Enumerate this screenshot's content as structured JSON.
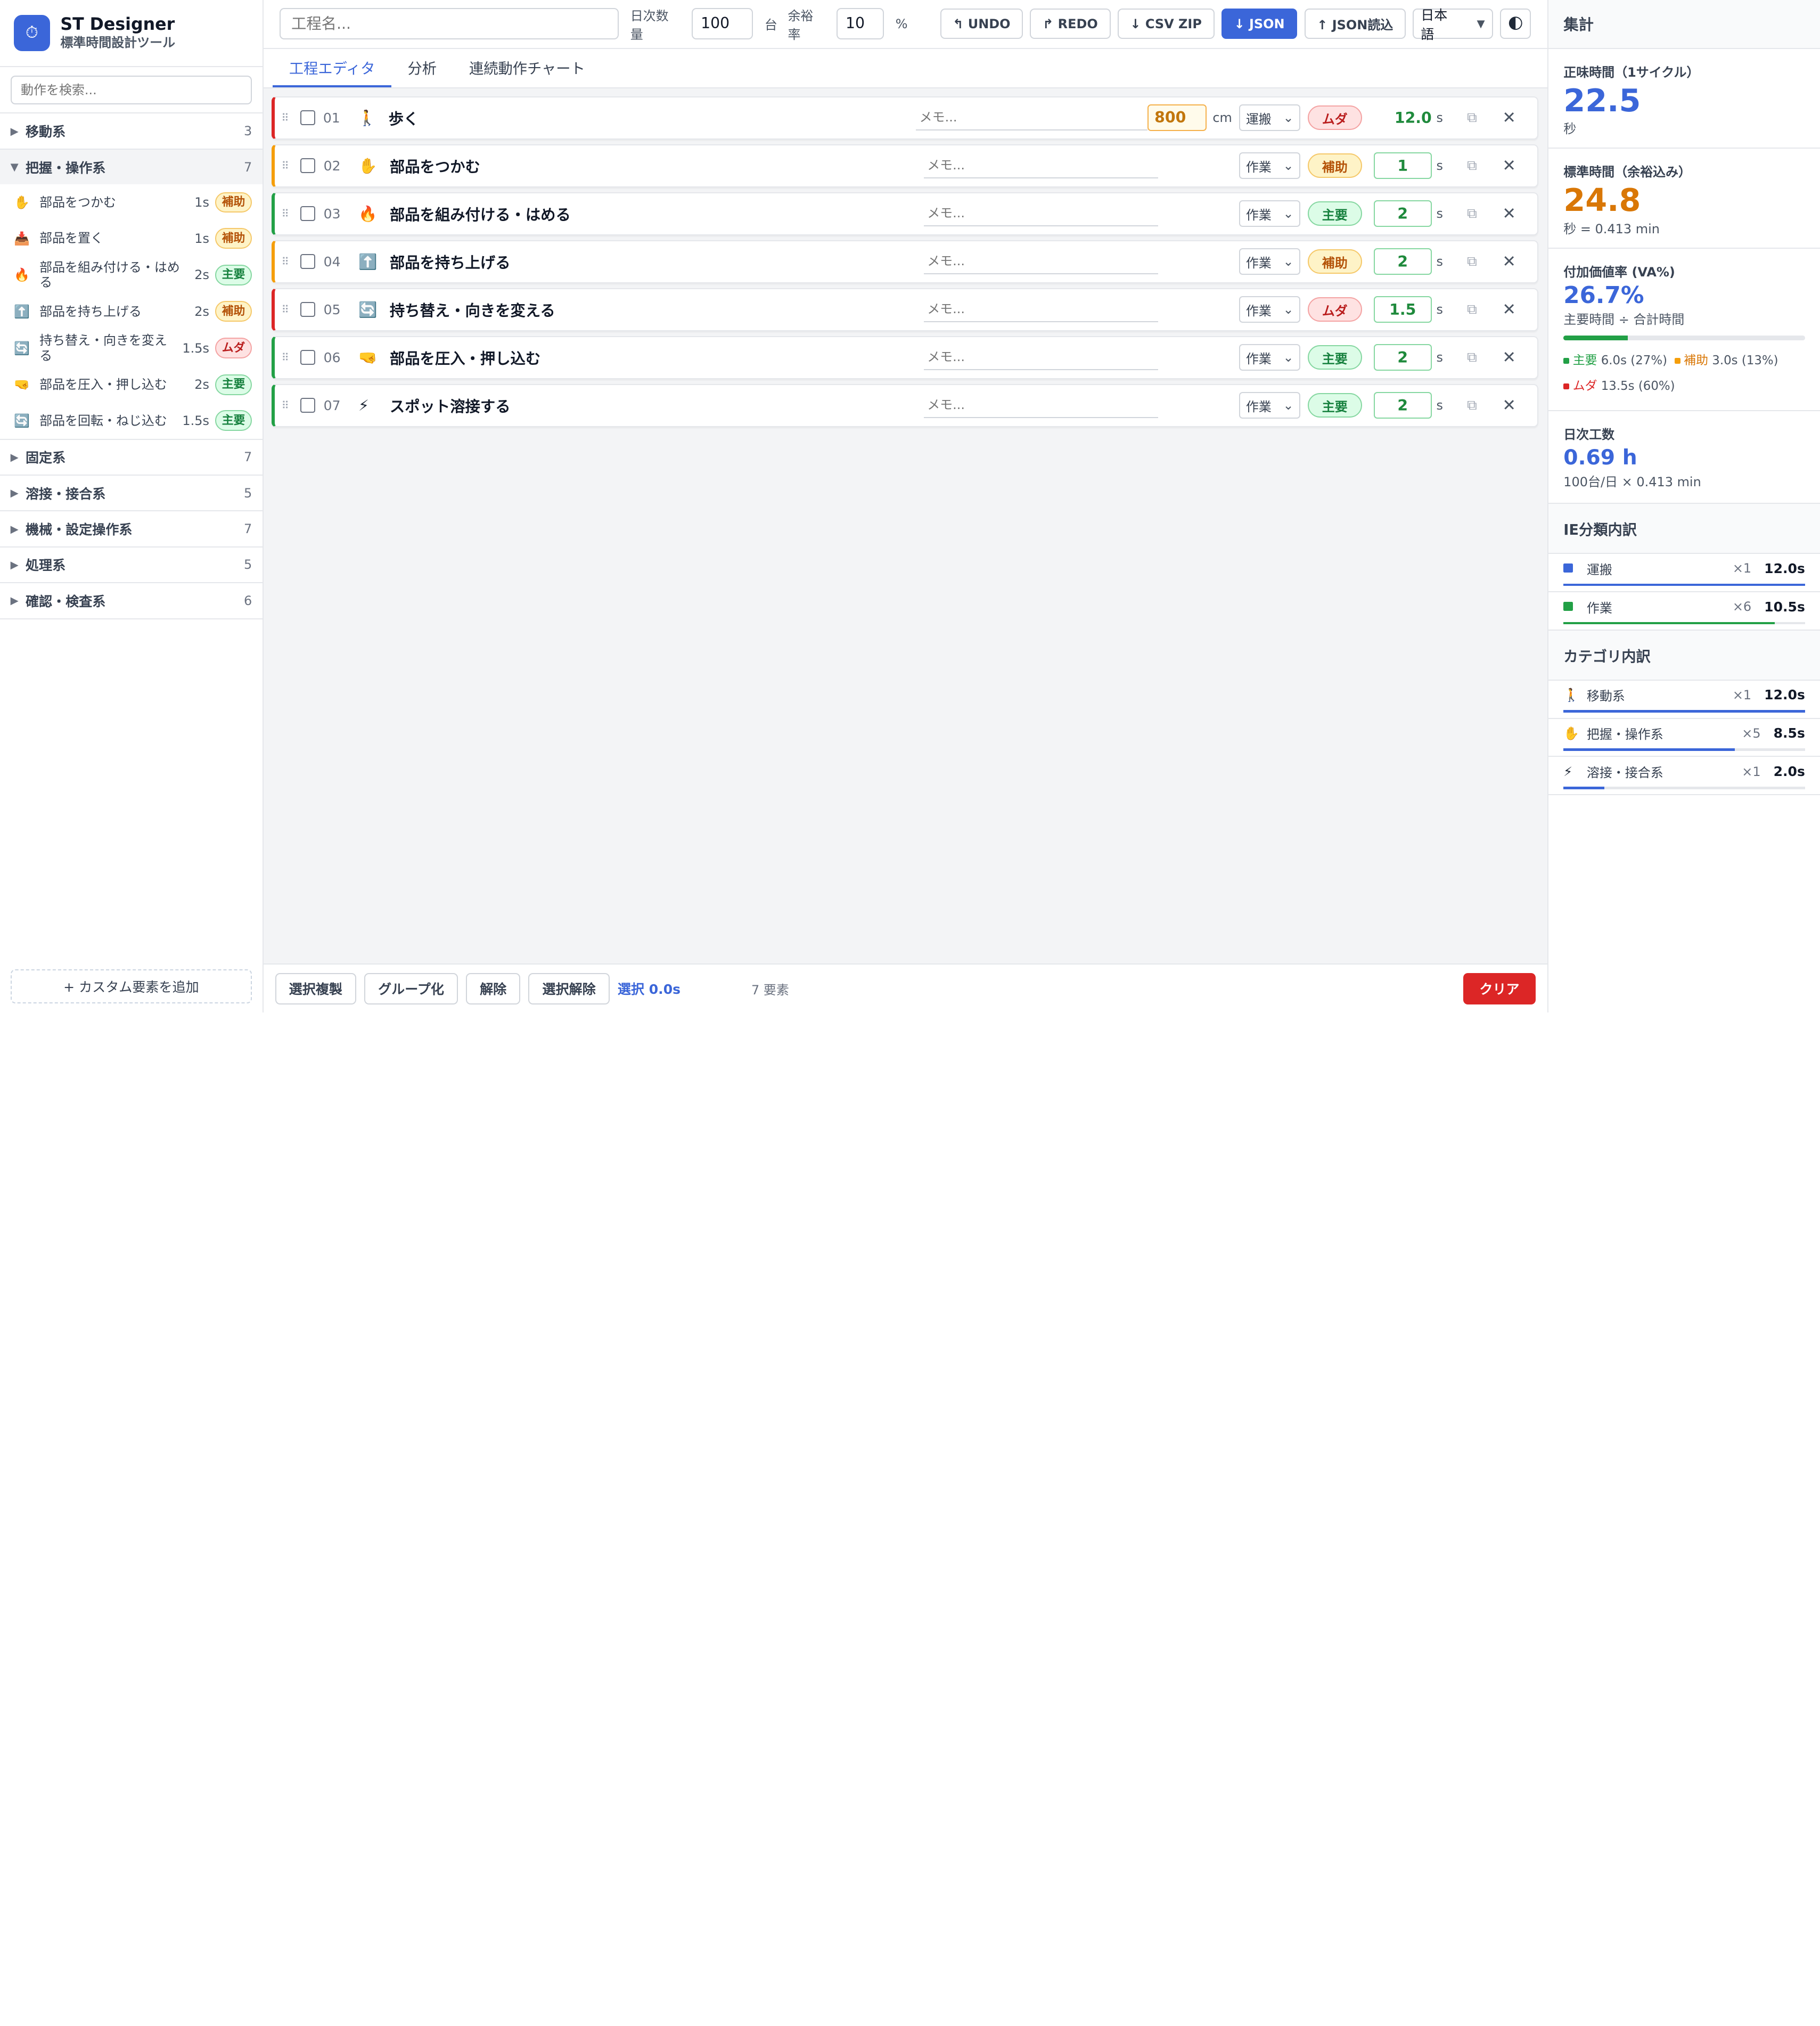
{
  "app": {
    "title": "ST Designer",
    "subtitle": "標準時間設計ツール"
  },
  "sidebar": {
    "search_placeholder": "動作を検索...",
    "categories": [
      {
        "name": "移動系",
        "count": "3",
        "open": false
      },
      {
        "name": "把握・操作系",
        "count": "7",
        "open": true,
        "items": [
          {
            "icon": "✋",
            "name": "部品をつかむ",
            "time": "1s",
            "badge": "補助",
            "kind": "aux"
          },
          {
            "icon": "📥",
            "name": "部品を置く",
            "time": "1s",
            "badge": "補助",
            "kind": "aux"
          },
          {
            "icon": "🔥",
            "name": "部品を組み付ける・はめる",
            "time": "2s",
            "badge": "主要",
            "kind": "main"
          },
          {
            "icon": "⬆️",
            "name": "部品を持ち上げる",
            "time": "2s",
            "badge": "補助",
            "kind": "aux"
          },
          {
            "icon": "🔄",
            "name": "持ち替え・向きを変える",
            "time": "1.5s",
            "badge": "ムダ",
            "kind": "muda"
          },
          {
            "icon": "🤜",
            "name": "部品を圧入・押し込む",
            "time": "2s",
            "badge": "主要",
            "kind": "main"
          },
          {
            "icon": "🔄",
            "name": "部品を回転・ねじ込む",
            "time": "1.5s",
            "badge": "主要",
            "kind": "main"
          }
        ]
      },
      {
        "name": "固定系",
        "count": "7",
        "open": false
      },
      {
        "name": "溶接・接合系",
        "count": "5",
        "open": false
      },
      {
        "name": "機械・設定操作系",
        "count": "7",
        "open": false
      },
      {
        "name": "処理系",
        "count": "5",
        "open": false
      },
      {
        "name": "確認・検査系",
        "count": "6",
        "open": false
      }
    ],
    "add_custom": "+ カスタム要素を追加"
  },
  "toolbar": {
    "process_placeholder": "工程名...",
    "daily_label": "日次数量",
    "daily_value": "100",
    "unit_label": "台",
    "allowance_label": "余裕率",
    "allowance_value": "10",
    "percent": "%",
    "undo": "↰ UNDO",
    "redo": "↱ REDO",
    "csv": "↓ CSV ZIP",
    "json": "↓ JSON",
    "json_load": "↑ JSON読込",
    "language": "日本語"
  },
  "tabs": [
    "工程エディタ",
    "分析",
    "連続動作チャート"
  ],
  "steps": [
    {
      "no": "01",
      "icon": "🚶",
      "name": "歩く",
      "memo": "メモ...",
      "distance": "800",
      "dist_unit": "cm",
      "type": "運搬",
      "badge": "ムダ",
      "kind": "muda",
      "time": "12.0",
      "editable": false
    },
    {
      "no": "02",
      "icon": "✋",
      "name": "部品をつかむ",
      "memo": "メモ...",
      "type": "作業",
      "badge": "補助",
      "kind": "aux",
      "time": "1",
      "editable": true
    },
    {
      "no": "03",
      "icon": "🔥",
      "name": "部品を組み付ける・はめる",
      "memo": "メモ...",
      "type": "作業",
      "badge": "主要",
      "kind": "main",
      "time": "2",
      "editable": true
    },
    {
      "no": "04",
      "icon": "⬆️",
      "name": "部品を持ち上げる",
      "memo": "メモ...",
      "type": "作業",
      "badge": "補助",
      "kind": "aux",
      "time": "2",
      "editable": true
    },
    {
      "no": "05",
      "icon": "🔄",
      "name": "持ち替え・向きを変える",
      "memo": "メモ...",
      "type": "作業",
      "badge": "ムダ",
      "kind": "muda",
      "time": "1.5",
      "editable": true
    },
    {
      "no": "06",
      "icon": "🤜",
      "name": "部品を圧入・押し込む",
      "memo": "メモ...",
      "type": "作業",
      "badge": "主要",
      "kind": "main",
      "time": "2",
      "editable": true
    },
    {
      "no": "07",
      "icon": "⚡",
      "name": "スポット溶接する",
      "memo": "メモ...",
      "type": "作業",
      "badge": "主要",
      "kind": "main",
      "time": "2",
      "editable": true
    }
  ],
  "time_unit": "s",
  "bottombar": {
    "copy_sel": "選択複製",
    "group": "グループ化",
    "ungroup": "解除",
    "deselect": "選択解除",
    "selected": "選択 0.0s",
    "count": "7 要素",
    "clear": "クリア"
  },
  "summary": {
    "title": "集計",
    "net_label": "正味時間（1サイクル）",
    "net_value": "22.5",
    "net_unit": "秒",
    "std_label": "標準時間（余裕込み）",
    "std_value": "24.8",
    "std_sub": "秒 = 0.413 min",
    "va_label": "付加価値率 (VA%)",
    "va_value": "26.7%",
    "va_sub": "主要時間 ÷ 合計時間",
    "va_fraction": 0.267,
    "legend": {
      "main_label": "主要",
      "main_value": "6.0s (27%)",
      "aux_label": "補助",
      "aux_value": "3.0s (13%)",
      "muda_label": "ムダ",
      "muda_value": "13.5s (60%)"
    },
    "workload_label": "日次工数",
    "workload_value": "0.69 h",
    "workload_sub": "100台/日 × 0.413 min"
  },
  "ie_breakdown": {
    "title": "IE分類内訳",
    "rows": [
      {
        "name": "運搬",
        "count": "×1",
        "value": "12.0s",
        "color": "#3b66d9",
        "fraction": 1.0
      },
      {
        "name": "作業",
        "count": "×6",
        "value": "10.5s",
        "color": "#22a046",
        "fraction": 0.875
      }
    ]
  },
  "category_breakdown": {
    "title": "カテゴリ内訳",
    "rows": [
      {
        "icon": "🚶",
        "name": "移動系",
        "count": "×1",
        "value": "12.0s",
        "fraction": 1.0
      },
      {
        "icon": "✋",
        "name": "把握・操作系",
        "count": "×5",
        "value": "8.5s",
        "fraction": 0.71
      },
      {
        "icon": "⚡",
        "name": "溶接・接合系",
        "count": "×1",
        "value": "2.0s",
        "fraction": 0.17
      }
    ]
  },
  "colors": {
    "accent": "#3b66d9",
    "muda": "#dc2626",
    "aux": "#f59e0b",
    "main": "#22a046"
  }
}
